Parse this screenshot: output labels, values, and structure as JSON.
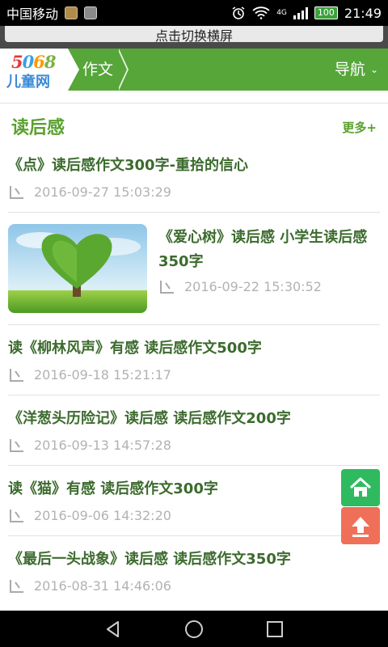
{
  "status_bar": {
    "carrier": "中国移动",
    "network": "4G",
    "battery": "100",
    "time": "21:49"
  },
  "rotate_banner": "点击切换横屏",
  "header": {
    "logo_number": "5068",
    "logo_text": "儿童网",
    "breadcrumb": "作文",
    "nav_label": "导航",
    "logo_colors": [
      "#e53935",
      "#3aa0e0",
      "#ff9800",
      "#7cb342"
    ]
  },
  "section": {
    "title": "读后感",
    "more": "更多+"
  },
  "articles": [
    {
      "title": "《点》读后感作文300字-重拾的信心",
      "date": "2016-09-27 15:03:29"
    },
    {
      "title": "《爱心树》读后感 小学生读后感350字",
      "date": "2016-09-22 15:30:52",
      "thumbnail": "heart-tree"
    },
    {
      "title": "读《柳林风声》有感 读后感作文500字",
      "date": "2016-09-18 15:21:17"
    },
    {
      "title": "《洋葱头历险记》读后感 读后感作文200字",
      "date": "2016-09-13 14:57:28"
    },
    {
      "title": "读《猫》有感 读后感作文300字",
      "date": "2016-09-06 14:32:20"
    },
    {
      "title": "《最后一头战象》读后感 读后感作文350字",
      "date": "2016-08-31 14:46:06"
    }
  ],
  "floating_buttons": {
    "home_icon": "home-icon",
    "top_icon": "scroll-top-icon",
    "home_color": "#2fba5f",
    "top_color": "#f06f58"
  }
}
